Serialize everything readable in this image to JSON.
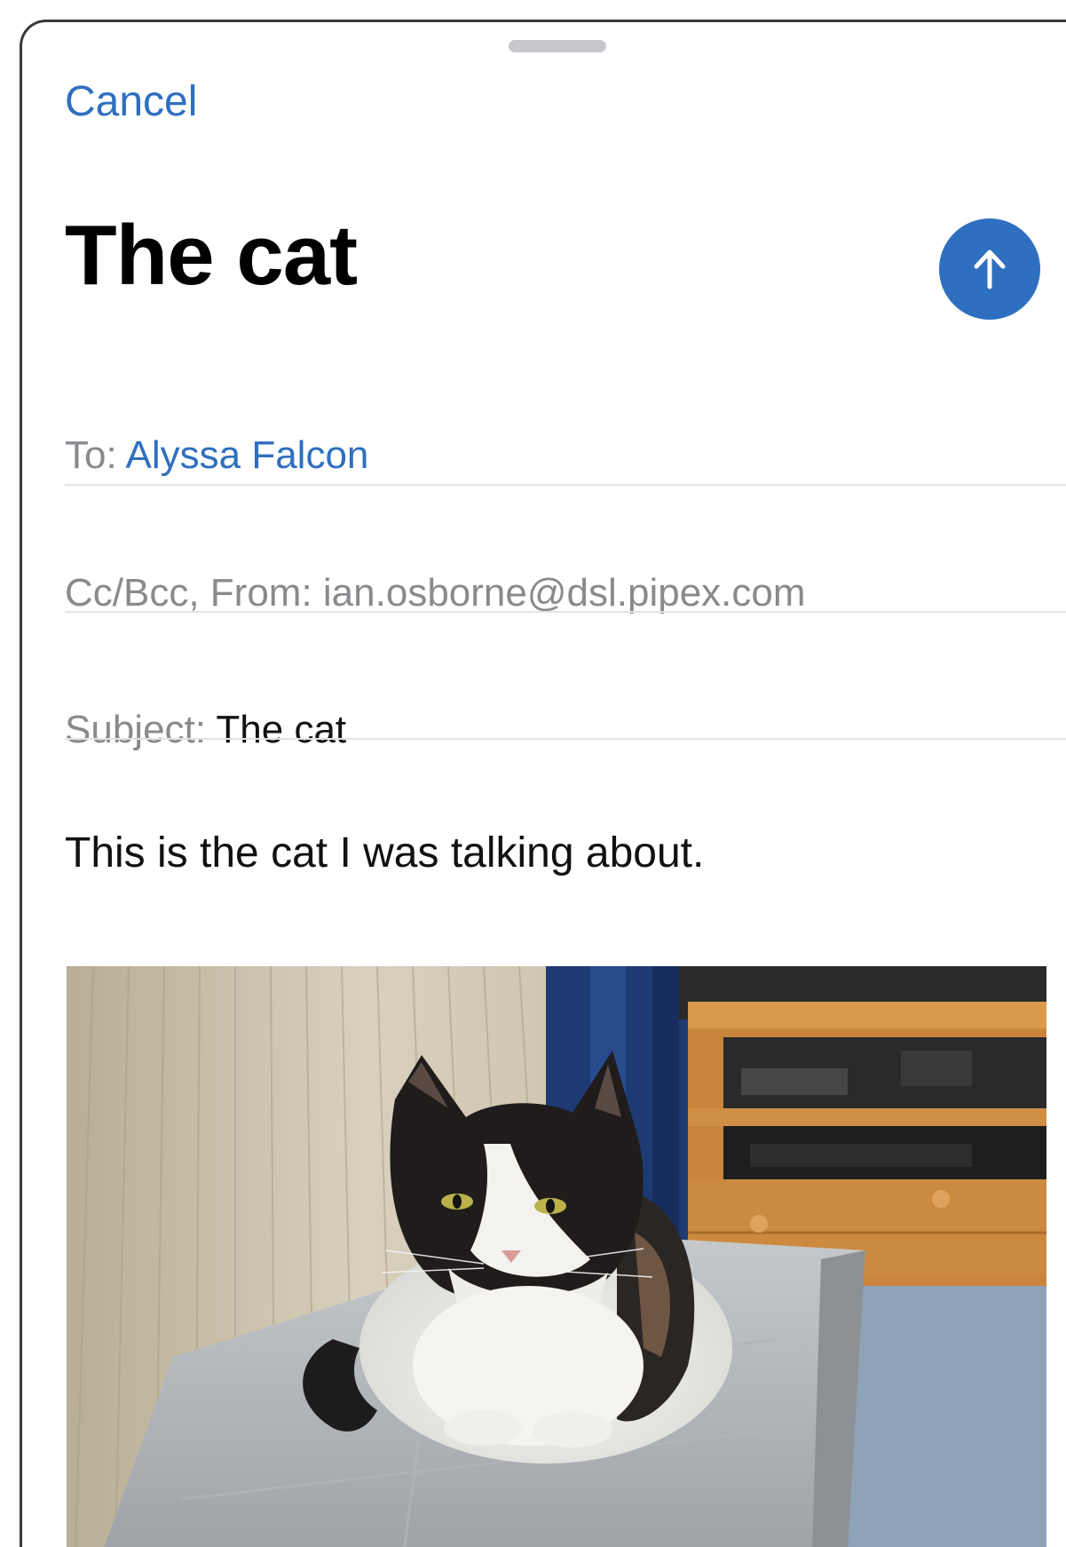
{
  "header": {
    "cancel_label": "Cancel",
    "title": "The cat"
  },
  "fields": {
    "to_label": "To:",
    "to_value": "Alyssa Falcon",
    "cc_label": "Cc/Bcc, From:",
    "cc_value": "ian.osborne@dsl.pipex.com",
    "subject_label": "Subject:",
    "subject_value": "The cat"
  },
  "body": {
    "text": "This is the cat I was talking about."
  },
  "icons": {
    "send": "arrow-up-icon",
    "attachment": "cat-photo"
  },
  "colors": {
    "accent": "#2f6fbf",
    "label_gray": "#8a8a8e",
    "separator": "#e3e3e6"
  }
}
